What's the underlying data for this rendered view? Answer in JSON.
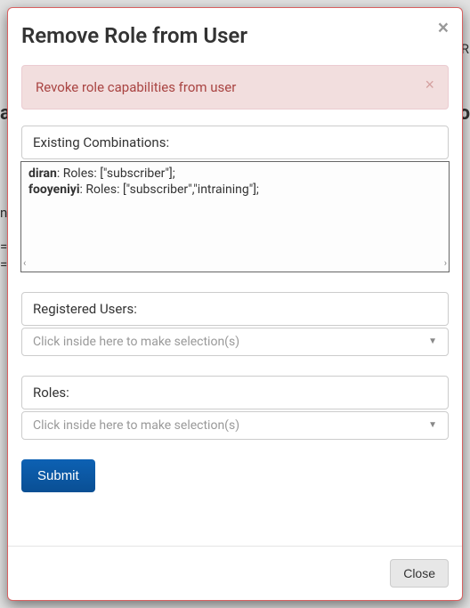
{
  "background": {
    "frag1": "R",
    "frag2": "a",
    "frag3": "o",
    "frag4": "n",
    "frag5": "=",
    "frag6": "="
  },
  "modal": {
    "title": "Remove Role from User",
    "close_x": "×",
    "alert": {
      "text": "Revoke role capabilities from user",
      "close": "×"
    },
    "existing_label": "Existing Combinations:",
    "combinations": [
      {
        "user": "diran",
        "roles_text": ": Roles: [\"subscriber\"];"
      },
      {
        "user": "fooyeniyi",
        "roles_text": ": Roles: [\"subscriber\",\"intraining\"];"
      }
    ],
    "registered_label": "Registered Users:",
    "select_placeholder": "Click inside here to make selection(s)",
    "roles_label": "Roles:",
    "submit": "Submit",
    "footer_close": "Close",
    "scroll_left": "‹",
    "scroll_right": "›"
  }
}
